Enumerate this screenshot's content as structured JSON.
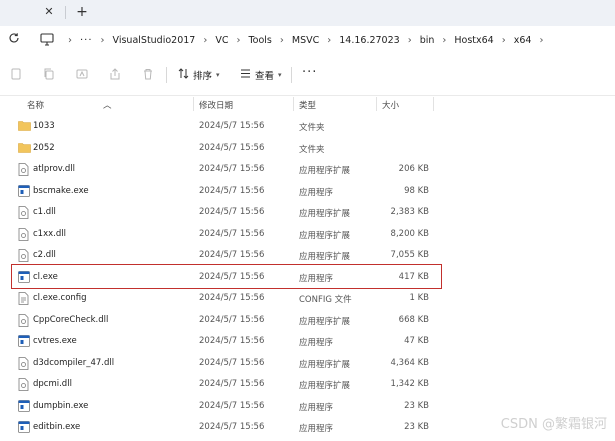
{
  "window": {
    "tab_close_glyph": "✕",
    "tab_add_glyph": "+"
  },
  "address": {
    "more": "···",
    "crumbs": [
      "VisualStudio2017",
      "VC",
      "Tools",
      "MSVC",
      "14.16.27023",
      "bin",
      "Hostx64",
      "x64"
    ]
  },
  "toolbar": {
    "sort_label": "排序",
    "view_label": "查看",
    "more": "···"
  },
  "columns": {
    "name": "名称",
    "date": "修改日期",
    "type": "类型",
    "size": "大小"
  },
  "files": [
    {
      "name": "1033",
      "date": "2024/5/7 15:56",
      "type": "文件夹",
      "size": "",
      "icon": "folder"
    },
    {
      "name": "2052",
      "date": "2024/5/7 15:56",
      "type": "文件夹",
      "size": "",
      "icon": "folder"
    },
    {
      "name": "atlprov.dll",
      "date": "2024/5/7 15:56",
      "type": "应用程序扩展",
      "size": "206 KB",
      "icon": "dll"
    },
    {
      "name": "bscmake.exe",
      "date": "2024/5/7 15:56",
      "type": "应用程序",
      "size": "98 KB",
      "icon": "exe"
    },
    {
      "name": "c1.dll",
      "date": "2024/5/7 15:56",
      "type": "应用程序扩展",
      "size": "2,383 KB",
      "icon": "dll"
    },
    {
      "name": "c1xx.dll",
      "date": "2024/5/7 15:56",
      "type": "应用程序扩展",
      "size": "8,200 KB",
      "icon": "dll"
    },
    {
      "name": "c2.dll",
      "date": "2024/5/7 15:56",
      "type": "应用程序扩展",
      "size": "7,055 KB",
      "icon": "dll"
    },
    {
      "name": "cl.exe",
      "date": "2024/5/7 15:56",
      "type": "应用程序",
      "size": "417 KB",
      "icon": "exe"
    },
    {
      "name": "cl.exe.config",
      "date": "2024/5/7 15:56",
      "type": "CONFIG 文件",
      "size": "1 KB",
      "icon": "config"
    },
    {
      "name": "CppCoreCheck.dll",
      "date": "2024/5/7 15:56",
      "type": "应用程序扩展",
      "size": "668 KB",
      "icon": "dll"
    },
    {
      "name": "cvtres.exe",
      "date": "2024/5/7 15:56",
      "type": "应用程序",
      "size": "47 KB",
      "icon": "exe"
    },
    {
      "name": "d3dcompiler_47.dll",
      "date": "2024/5/7 15:56",
      "type": "应用程序扩展",
      "size": "4,364 KB",
      "icon": "dll"
    },
    {
      "name": "dpcmi.dll",
      "date": "2024/5/7 15:56",
      "type": "应用程序扩展",
      "size": "1,342 KB",
      "icon": "dll"
    },
    {
      "name": "dumpbin.exe",
      "date": "2024/5/7 15:56",
      "type": "应用程序",
      "size": "23 KB",
      "icon": "exe"
    },
    {
      "name": "editbin.exe",
      "date": "2024/5/7 15:56",
      "type": "应用程序",
      "size": "23 KB",
      "icon": "exe"
    }
  ],
  "watermark": "CSDN @繁霜银河",
  "colors": {
    "highlight_border": "#c2302d",
    "folder": "#f2c55c",
    "exe_accent": "#1f5fb8"
  }
}
